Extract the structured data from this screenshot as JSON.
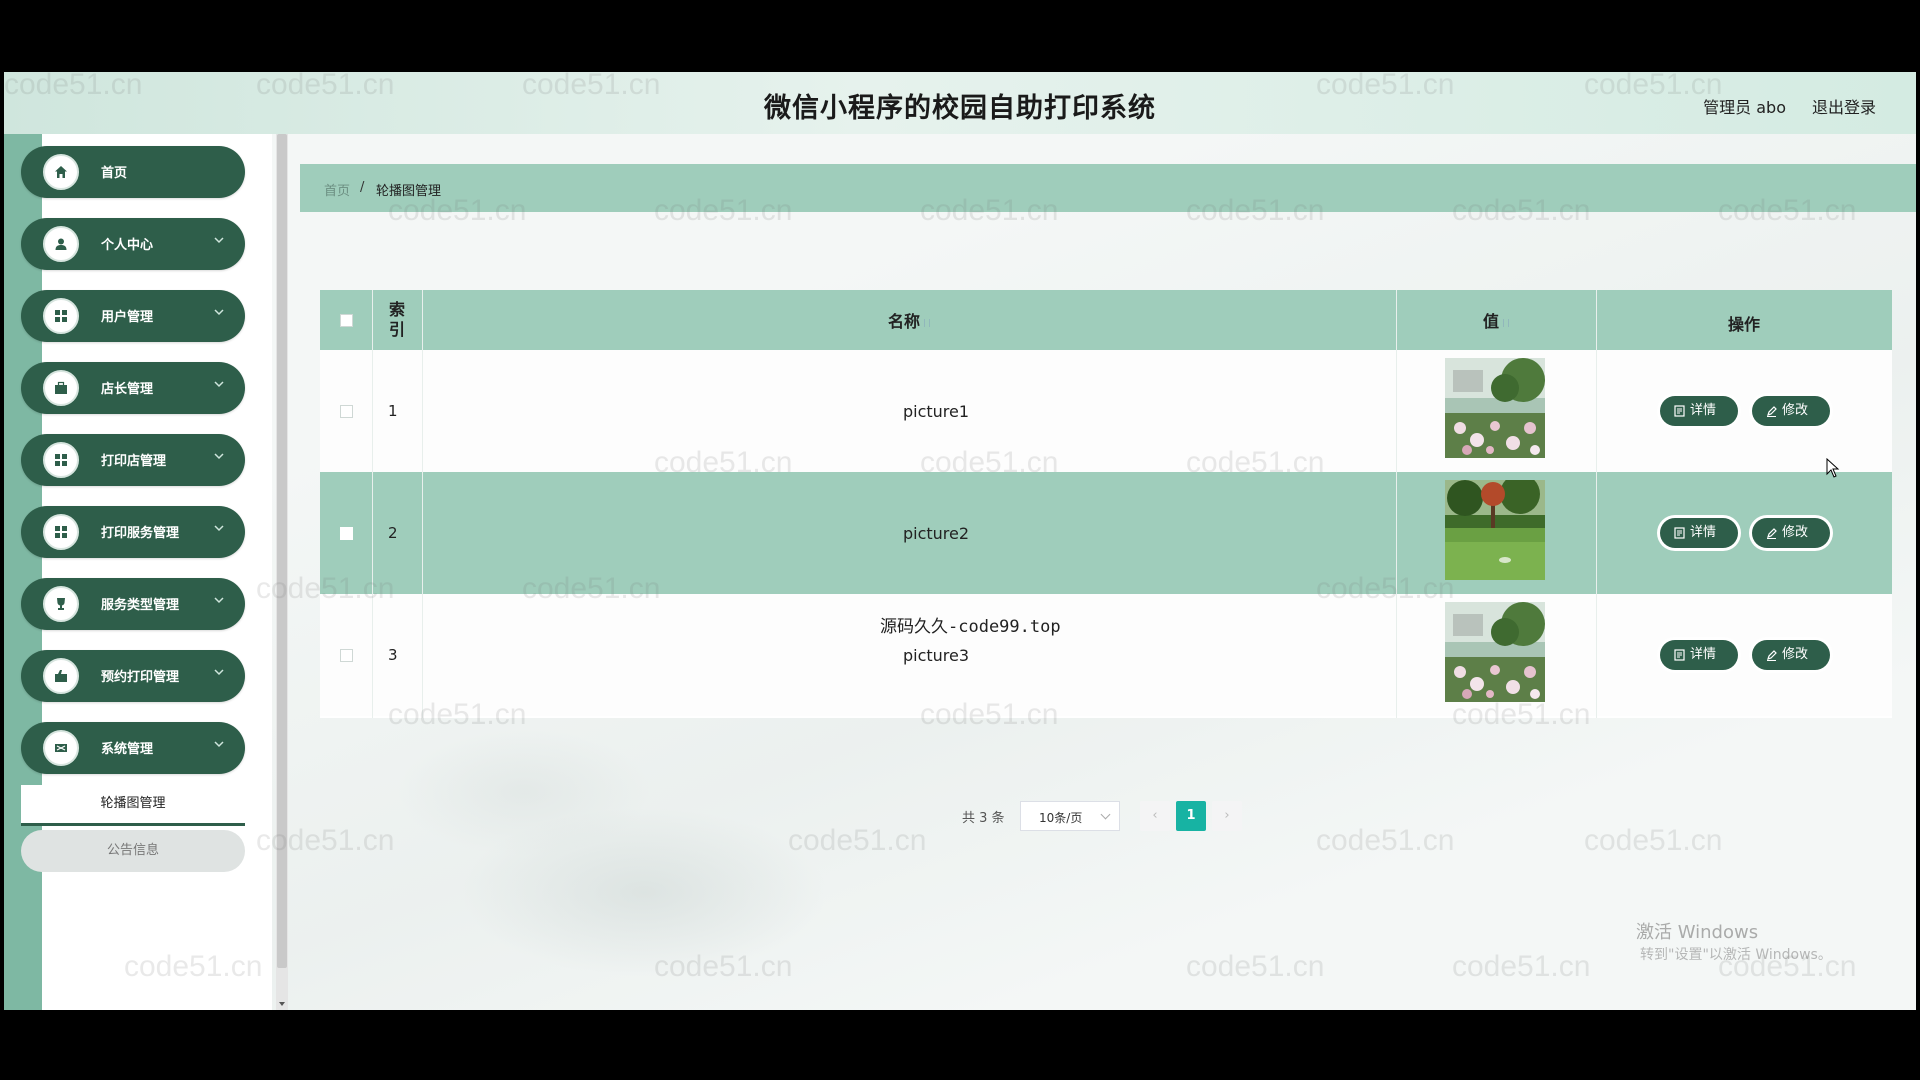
{
  "header": {
    "title": "微信小程序的校园自助打印系统",
    "user": "管理员 abo",
    "logout": "退出登录"
  },
  "sidebar": {
    "items": [
      {
        "label": "首页",
        "icon": "home-icon",
        "has_arrow": false
      },
      {
        "label": "个人中心",
        "icon": "user-icon",
        "has_arrow": true
      },
      {
        "label": "用户管理",
        "icon": "grid-icon",
        "has_arrow": true
      },
      {
        "label": "店长管理",
        "icon": "briefcase-icon",
        "has_arrow": true
      },
      {
        "label": "打印店管理",
        "icon": "grid-icon",
        "has_arrow": true
      },
      {
        "label": "打印服务管理",
        "icon": "grid-icon",
        "has_arrow": true
      },
      {
        "label": "服务类型管理",
        "icon": "trophy-icon",
        "has_arrow": true
      },
      {
        "label": "预约打印管理",
        "icon": "briefcase-icon",
        "has_arrow": true
      },
      {
        "label": "系统管理",
        "icon": "settings-icon",
        "has_arrow": true
      }
    ],
    "submenu_active": "轮播图管理",
    "submenu_item": "公告信息"
  },
  "breadcrumb": {
    "home": "首页",
    "separator": "/",
    "current": "轮播图管理"
  },
  "table": {
    "headers": {
      "index": "索引",
      "name": "名称",
      "value": "值",
      "actions": "操作"
    },
    "rows": [
      {
        "index": "1",
        "name": "picture1",
        "image": "flowers-garden"
      },
      {
        "index": "2",
        "name": "picture2",
        "image": "lawn-park"
      },
      {
        "index": "3",
        "name": "picture3",
        "image": "flowers-garden"
      }
    ],
    "detail_label": "详情",
    "edit_label": "修改"
  },
  "pagination": {
    "total": "共 3 条",
    "page_size": "10条/页",
    "current_page": "1"
  },
  "overlay_text": "源码久久-code99.top",
  "watermark": "code51.cn",
  "os_notice": {
    "line1": "激活 Windows",
    "line2": "转到\"设置\"以激活 Windows。"
  },
  "colors": {
    "sidebar_item": "#2e5e4a",
    "table_header": "#9fcdbb",
    "pager_active": "#17b3a3"
  }
}
